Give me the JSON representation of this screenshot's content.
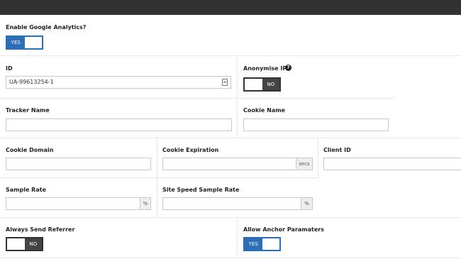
{
  "form": {
    "enable_ga": {
      "label": "Enable Google Analytics?",
      "toggle": "YES"
    },
    "id": {
      "label": "ID",
      "value": "UA-99613254-1"
    },
    "anonymise_ip": {
      "label": "Anonymise IP?",
      "toggle": "NO",
      "help_icon": "?"
    },
    "tracker_name": {
      "label": "Tracker Name",
      "value": ""
    },
    "cookie_name": {
      "label": "Cookie Name",
      "value": ""
    },
    "cookie_domain": {
      "label": "Cookie Domain",
      "value": ""
    },
    "cookie_expiration": {
      "label": "Cookie Expiration",
      "value": "",
      "suffix": "secs"
    },
    "client_id": {
      "label": "Client ID",
      "value": ""
    },
    "sample_rate": {
      "label": "Sample Rate",
      "value": "",
      "suffix": "%"
    },
    "site_speed_sample_rate": {
      "label": "Site Speed Sample Rate",
      "value": "",
      "suffix": "%"
    },
    "always_send_referrer": {
      "label": "Always Send Referrer",
      "toggle": "NO"
    },
    "allow_anchor_parameters": {
      "label": "Allow Anchor Paramaters",
      "toggle": "YES"
    }
  },
  "colors": {
    "topbar": "#323232",
    "toggle_on": "#2c6fb6",
    "toggle_off": "#444444"
  },
  "icons": {
    "id_field_icon": "contact-card-icon",
    "anonymise_help": "question-circle-icon"
  }
}
